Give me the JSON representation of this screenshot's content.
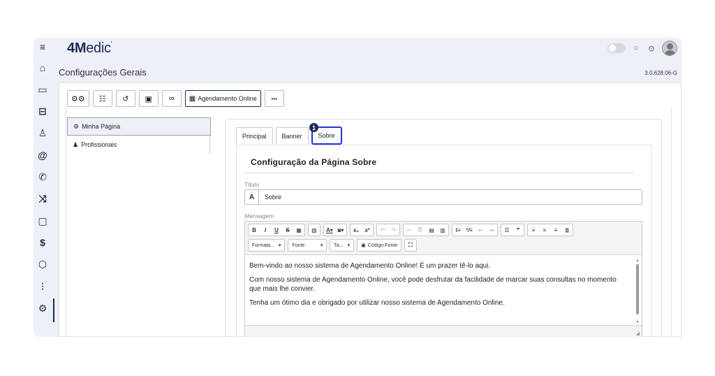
{
  "app": {
    "logo_bold": "4M",
    "logo_light": "edic",
    "logo_mark": "'"
  },
  "header": {
    "page_title": "Configurações Gerais",
    "version": "3.0.628.06-G"
  },
  "sidebar": {
    "icons": [
      "menu-icon",
      "home-icon",
      "calendar-icon",
      "sofa-icon",
      "person-icon",
      "at-icon",
      "phone-icon",
      "shuffle-icon",
      "clipboard-icon",
      "dollar-icon",
      "cube-icon",
      "chart-icon",
      "settings-icon"
    ],
    "active": "settings-icon"
  },
  "tool_tabs": {
    "active_label": "Agendamento Online",
    "more_label": "•••"
  },
  "left_nav": {
    "items": [
      {
        "label": "Minha Página",
        "icon": "gear-icon"
      },
      {
        "label": "Profissionais",
        "icon": "professionals-icon"
      }
    ]
  },
  "sub_tabs": {
    "items": [
      "Principal",
      "Banner",
      "Sobre"
    ],
    "active": "Sobre",
    "badge": "1"
  },
  "form": {
    "section_title": "Configuração da Página Sobre",
    "title_label": "Título",
    "title_icon": "A",
    "title_value": "Sobre",
    "message_label": "Mensagem"
  },
  "editor": {
    "combo_format": "Formata...",
    "combo_font": "Fonte",
    "combo_size": "Ta...",
    "source_label": "Código-Fonte",
    "paragraphs": [
      "Bem-vindo ao nosso sistema de Agendamento Online! É um prazer tê-lo aqui.",
      "Com nosso sistema de Agendamento Online, você pode desfrutar da facilidade de marcar suas consultas no momento que mais lhe convier.",
      "Tenha um ótimo dia e obrigado por utilizar nosso sistema de Agendamento Online."
    ]
  },
  "colors": {
    "brand": "#1c2a59",
    "highlight": "#1f34d4",
    "background": "#eef0f7"
  }
}
